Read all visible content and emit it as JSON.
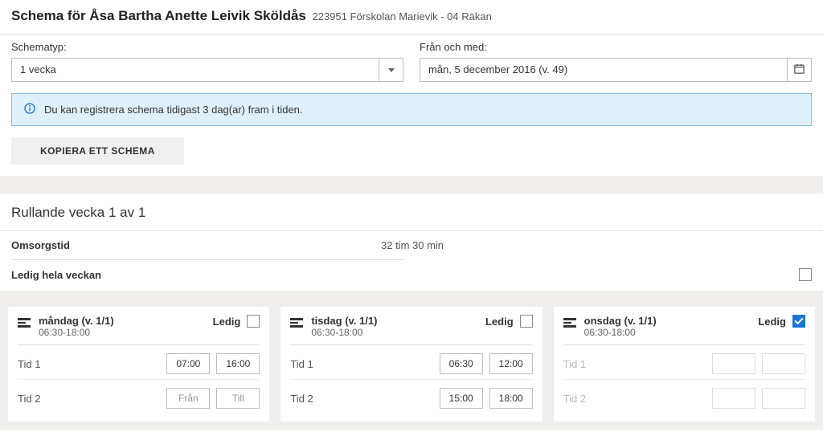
{
  "header": {
    "title": "Schema för Åsa Bartha Anette Leivik Sköldås",
    "subtitle": "223951 Förskolan Marievik - 04 Räkan"
  },
  "controls": {
    "schemetype_label": "Schematyp:",
    "schemetype_value": "1 vecka",
    "from_label": "Från och med:",
    "from_value": "mån, 5 december 2016 (v. 49)"
  },
  "info_text": "Du kan registrera schema tidigast 3 dag(ar) fram i tiden.",
  "copy_button": "KOPIERA ETT SCHEMA",
  "week": {
    "title": "Rullande vecka 1 av 1",
    "care_label": "Omsorgstid",
    "care_value": "32 tim 30 min",
    "free_week_label": "Ledig hela veckan"
  },
  "labels": {
    "ledig": "Ledig",
    "tid1": "Tid 1",
    "tid2": "Tid 2",
    "from_ph": "Från",
    "to_ph": "Till"
  },
  "days": [
    {
      "title": "måndag (v. 1/1)",
      "hours": "06:30-18:00",
      "ledig": false,
      "tid1_from": "07:00",
      "tid1_to": "16:00",
      "tid2_from": "",
      "tid2_to": ""
    },
    {
      "title": "tisdag (v. 1/1)",
      "hours": "06:30-18:00",
      "ledig": false,
      "tid1_from": "06:30",
      "tid1_to": "12:00",
      "tid2_from": "15:00",
      "tid2_to": "18:00"
    },
    {
      "title": "onsdag (v. 1/1)",
      "hours": "06:30-18:00",
      "ledig": true,
      "tid1_from": "",
      "tid1_to": "",
      "tid2_from": "",
      "tid2_to": ""
    }
  ]
}
